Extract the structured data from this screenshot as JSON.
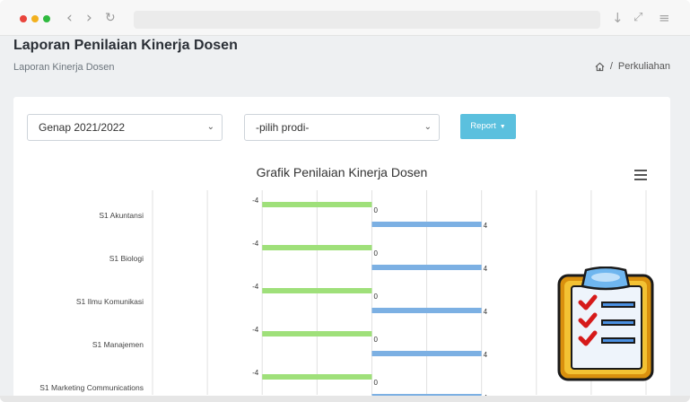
{
  "page": {
    "title": "Laporan Penilaian Kinerja Dosen",
    "subtitle": "Laporan Kinerja Dosen",
    "breadcrumb": {
      "separator": "/",
      "current": "Perkuliahan"
    }
  },
  "filters": {
    "semester": "Genap 2021/2022",
    "prodi": "-pilih prodi-",
    "report_label": "Report"
  },
  "chart_data": {
    "type": "bar",
    "orientation": "horizontal",
    "title": "Grafik Penilaian Kinerja Dosen",
    "categories": [
      "S1 Akuntansi",
      "S1 Biologi",
      "S1 Ilmu Komunikasi",
      "S1 Manajemen",
      "S1 Marketing Communications"
    ],
    "series": [
      {
        "values": [
          -4,
          -4,
          -4,
          -4,
          -4
        ],
        "color": "#9fe07a"
      },
      {
        "values": [
          0,
          0,
          0,
          0,
          0
        ],
        "color": "#9fe07a"
      },
      {
        "values": [
          4,
          4,
          4,
          4,
          4
        ],
        "color": "#7cb0e3"
      }
    ],
    "grid": true,
    "xlim": [
      -8,
      10
    ]
  },
  "colors": {
    "accent": "#5bc0de",
    "green_bar": "#9fe07a",
    "blue_bar": "#7cb0e3"
  },
  "icons": [
    "home-icon",
    "menu-icon",
    "clipboard-checklist-icon"
  ]
}
